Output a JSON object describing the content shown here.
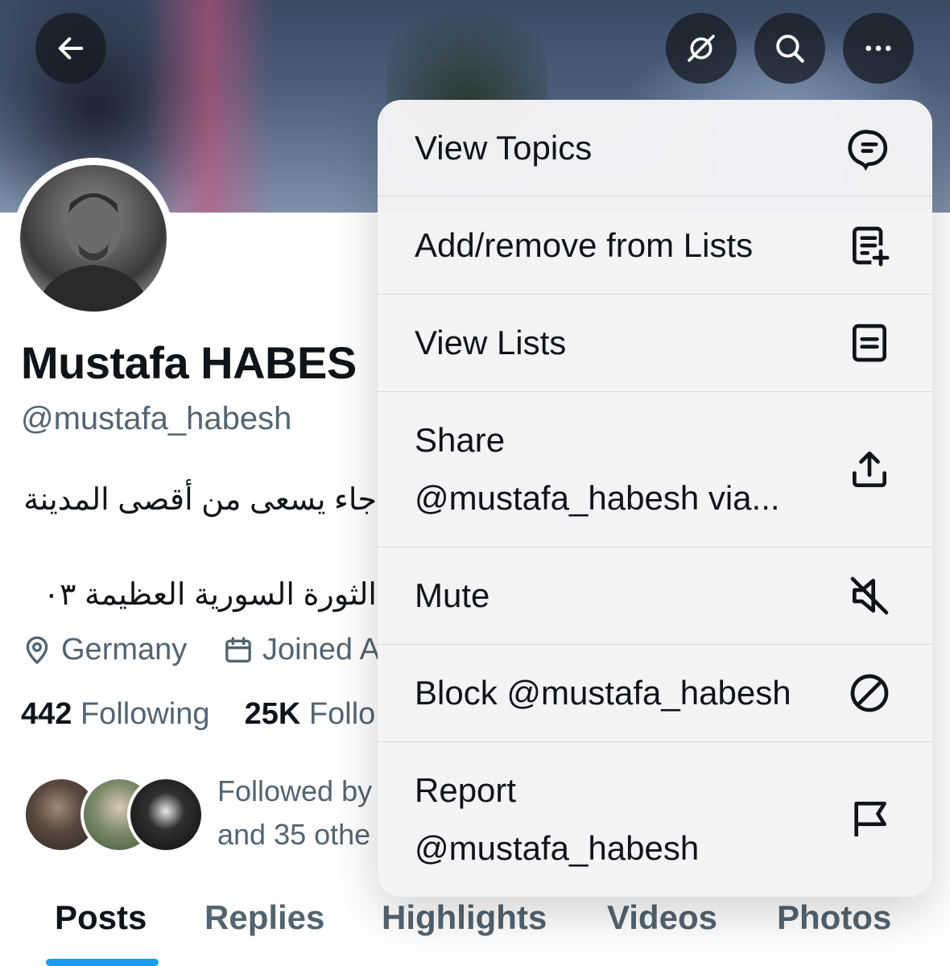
{
  "profile": {
    "name": "Mustafa HABES",
    "handle": "@mustafa_habesh",
    "bio_line1": "جاء يسعى من أقصى المدينة",
    "bio_line2": "الثورة السورية العظيمة ٠٣",
    "location": "Germany",
    "joined": "Joined A",
    "following_count": "442",
    "following_label": "Following",
    "followers_count": "25K",
    "followers_label": "Follo",
    "followed_by_line1": "Followed by",
    "followed_by_line2": "and 35 othe"
  },
  "header_buttons": {
    "back": "arrow-left-icon",
    "translate": "globe-off-icon",
    "search": "search-icon",
    "more": "more-icon"
  },
  "menu": {
    "items": [
      {
        "label": "View Topics",
        "icon": "topics-icon"
      },
      {
        "label": "Add/remove from Lists",
        "icon": "list-add-icon"
      },
      {
        "label": "View Lists",
        "icon": "lists-icon"
      },
      {
        "label": "Share\n@mustafa_habesh via...",
        "label_line1": "Share",
        "label_line2": "@mustafa_habesh via...",
        "icon": "share-icon"
      },
      {
        "label": "Mute",
        "icon": "mute-icon"
      },
      {
        "label": "Block @mustafa_habesh",
        "icon": "block-icon"
      },
      {
        "label": "Report\n@mustafa_habesh",
        "label_line1": "Report",
        "label_line2": "@mustafa_habesh",
        "icon": "flag-icon"
      }
    ]
  },
  "tabs": [
    "Posts",
    "Replies",
    "Highlights",
    "Videos",
    "Photos"
  ],
  "active_tab": "Posts",
  "colors": {
    "accent": "#1d9bf0",
    "secondary_text": "#536471",
    "primary_text": "#0f1419"
  }
}
